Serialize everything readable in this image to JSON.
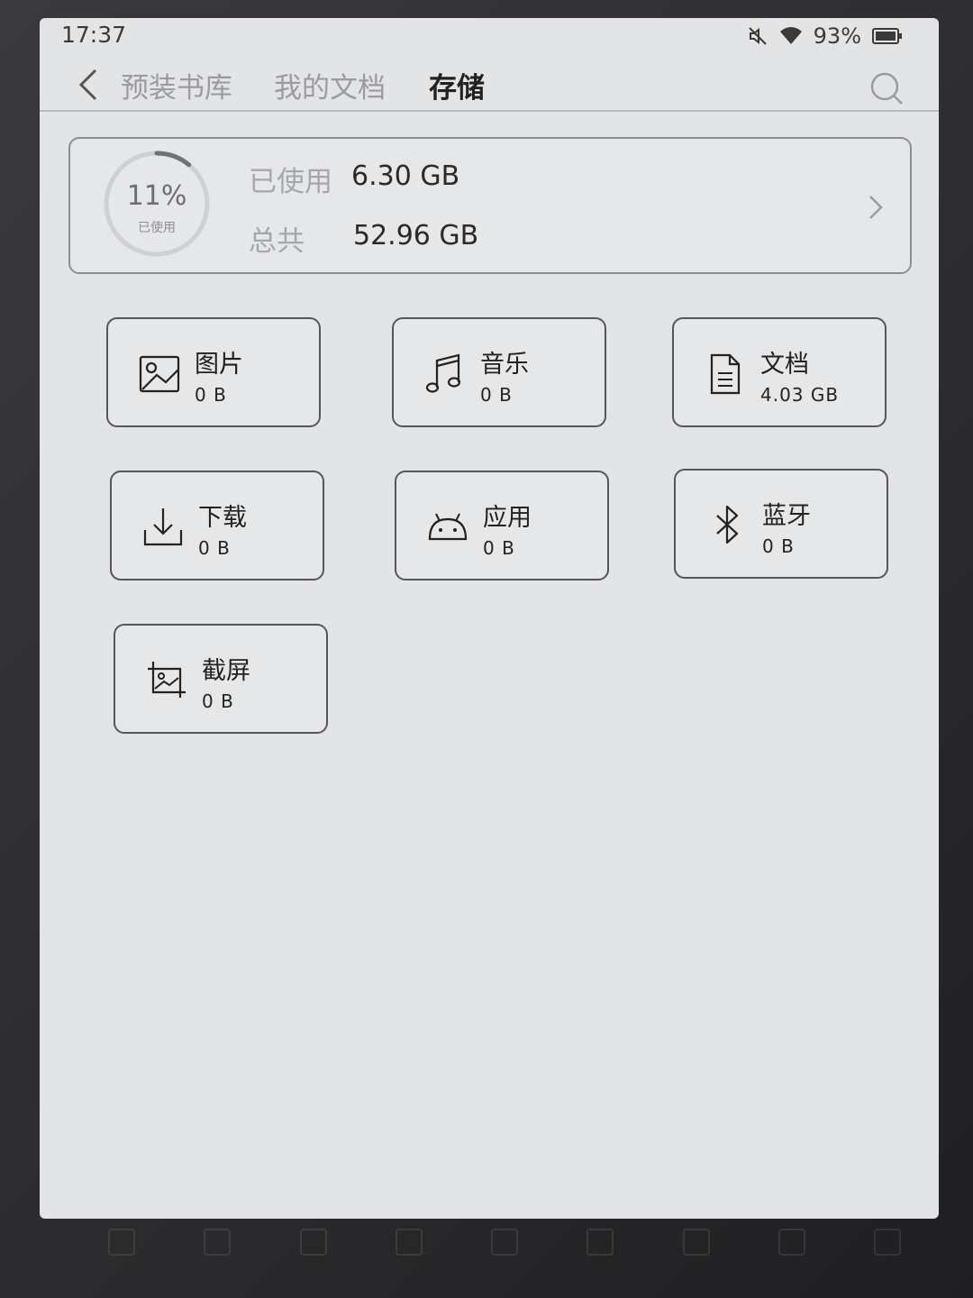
{
  "status_bar": {
    "time": "17:37",
    "battery_percent": "93%"
  },
  "nav": {
    "tabs": [
      {
        "label": "预装书库",
        "active": false
      },
      {
        "label": "我的文档",
        "active": false
      },
      {
        "label": "存储",
        "active": true
      }
    ]
  },
  "summary": {
    "used_percent_label": "11%",
    "used_percent_value": 11,
    "ring_caption": "已使用",
    "used_label": "已使用",
    "used_value": "6.30 GB",
    "total_label": "总共",
    "total_value": "52.96 GB"
  },
  "categories": [
    {
      "name": "图片",
      "size": "0 B",
      "icon": "image-icon"
    },
    {
      "name": "音乐",
      "size": "0 B",
      "icon": "music-note-icon"
    },
    {
      "name": "文档",
      "size": "4.03 GB",
      "icon": "document-icon"
    },
    {
      "name": "下载",
      "size": "0 B",
      "icon": "download-icon"
    },
    {
      "name": "应用",
      "size": "0 B",
      "icon": "android-icon"
    },
    {
      "name": "蓝牙",
      "size": "0 B",
      "icon": "bluetooth-icon"
    },
    {
      "name": "截屏",
      "size": "0 B",
      "icon": "screenshot-icon"
    }
  ],
  "colors": {
    "screen_bg": "#e3e4e6",
    "tile_border": "#555659",
    "inactive_tab": "#9a9b9e"
  }
}
